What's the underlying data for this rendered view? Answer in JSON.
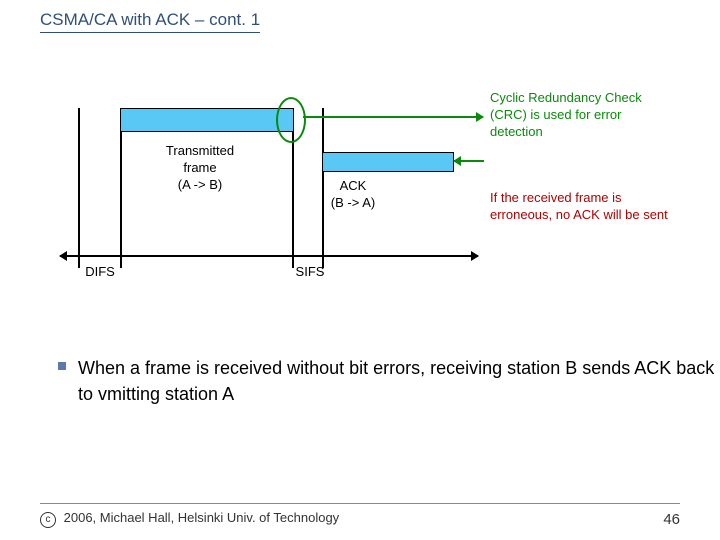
{
  "title": "CSMA/CA with ACK – cont. 1",
  "diagram": {
    "tx_label_line1": "Transmitted",
    "tx_label_line2": "frame",
    "tx_label_line3": "(A -> B)",
    "ack_label_line1": "ACK",
    "ack_label_line2": "(B -> A)",
    "crc_label": "Cyclic Redundancy Check (CRC) is used for error detection",
    "no_ack_label": "If the received frame is erroneous, no ACK will be sent",
    "difs": "DIFS",
    "sifs": "SIFS"
  },
  "bullet": "When a frame is received without bit errors, receiving station B sends ACK back to vmitting station A",
  "footer": {
    "copyright_symbol": "c",
    "copyright": "2006, Michael Hall, Helsinki Univ. of Technology",
    "page": "46"
  }
}
